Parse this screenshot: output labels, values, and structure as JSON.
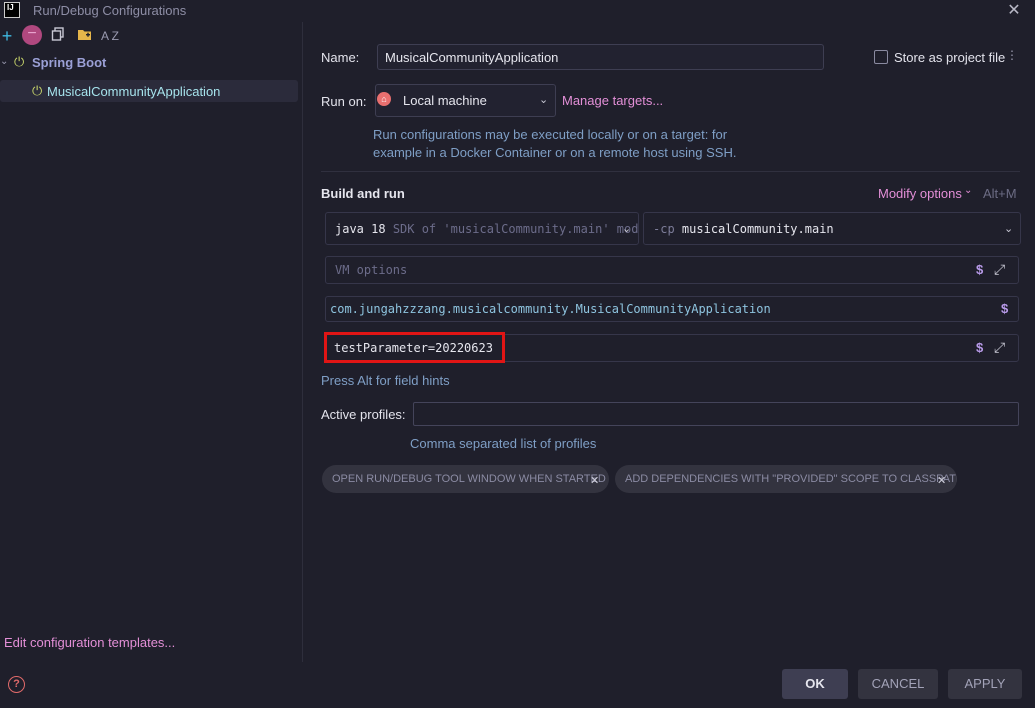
{
  "window": {
    "title": "Run/Debug Configurations",
    "logo_text": "IJ"
  },
  "toolbar": {
    "add_icon": "+",
    "remove_icon": "−",
    "copy_icon": "⧉",
    "folder_icon": "▰",
    "sort_icon": "A Z"
  },
  "tree": {
    "group_label": "Spring Boot",
    "items": [
      {
        "label": "MusicalCommunityApplication"
      }
    ]
  },
  "left_footer": {
    "edit_templates": "Edit configuration templates..."
  },
  "config": {
    "name_label": "Name:",
    "name_value": "MusicalCommunityApplication",
    "store_label": "Store as project file",
    "run_on_label": "Run on:",
    "run_on_value": "Local machine",
    "manage_targets": "Manage targets...",
    "run_on_hint_line1": "Run configurations may be executed locally or on a target: for",
    "run_on_hint_line2": "example in a Docker Container or on a remote host using SSH."
  },
  "build": {
    "section_label": "Build and run",
    "modify_options": "Modify options",
    "modify_shortcut": "Alt+M",
    "jdk_main": "java 18",
    "jdk_sub": "SDK of 'musicalCommunity.main' mod",
    "cp_prefix": "-cp",
    "cp_value": "musicalCommunity.main",
    "vm_placeholder": "VM options",
    "main_class": "com.jungahzzzang.musicalcommunity.MusicalCommunityApplication",
    "program_args": "testParameter=20220623",
    "field_hints": "Press Alt for field hints"
  },
  "profiles": {
    "label": "Active profiles:",
    "value": "",
    "hint": "Comma separated list of profiles"
  },
  "chips": [
    {
      "label": "OPEN RUN/DEBUG TOOL WINDOW WHEN STARTED"
    },
    {
      "label": "ADD DEPENDENCIES WITH \"PROVIDED\" SCOPE TO CLASSPATH"
    }
  ],
  "buttons": {
    "ok": "OK",
    "cancel": "CANCEL",
    "apply": "APPLY"
  },
  "icons": {
    "close": "✕",
    "spring": "⏻",
    "run_config": "⏻",
    "home": "⌂",
    "chevron": "⌄",
    "dollar": "$",
    "expand": "⤢",
    "chip_close": "✕",
    "help": "?",
    "more": "⋮"
  },
  "colors": {
    "accent_link": "#e38fd7",
    "highlight_box": "#e01515",
    "background": "#1f1f2b"
  }
}
